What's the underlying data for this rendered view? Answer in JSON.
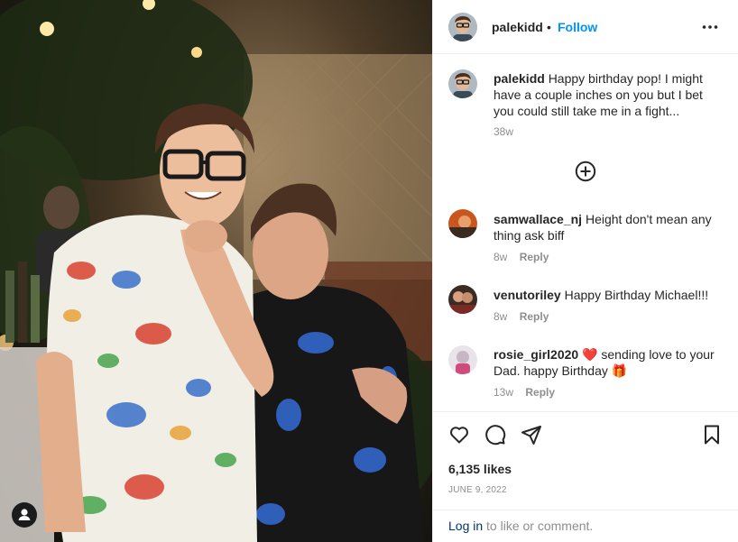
{
  "post": {
    "username": "palekidd",
    "follow_label": "Follow",
    "separator": "•",
    "caption": {
      "username": "palekidd",
      "text": "Happy birthday pop! I might have a couple inches on you but I bet you could still take me in a fight...",
      "time": "38w"
    },
    "comments": [
      {
        "username": "samwallace_nj",
        "text": "Height don't mean any thing ask biff",
        "time": "8w",
        "reply": "Reply"
      },
      {
        "username": "venutoriley",
        "text": "Happy Birthday Michael!!!",
        "time": "8w",
        "reply": "Reply"
      },
      {
        "username": "rosie_girl2020",
        "text_before": "sending love to your Dad. happy Birthday",
        "emoji_heart": "❤️",
        "emoji_gift": "🎁",
        "time": "13w",
        "reply": "Reply"
      }
    ],
    "likes": "6,135 likes",
    "date": "JUNE 9, 2022",
    "login": {
      "link": "Log in",
      "rest": " to like or comment."
    }
  },
  "colors": {
    "accent": "#0095f6",
    "text": "#262626",
    "muted": "#8e8e8e",
    "border": "#efefef",
    "heart": "#ed4956"
  },
  "icons": [
    "more-options-icon",
    "load-more-plus-icon",
    "like-heart-icon",
    "comment-bubble-icon",
    "share-paper-plane-icon",
    "save-bookmark-icon",
    "user-tag-icon"
  ]
}
